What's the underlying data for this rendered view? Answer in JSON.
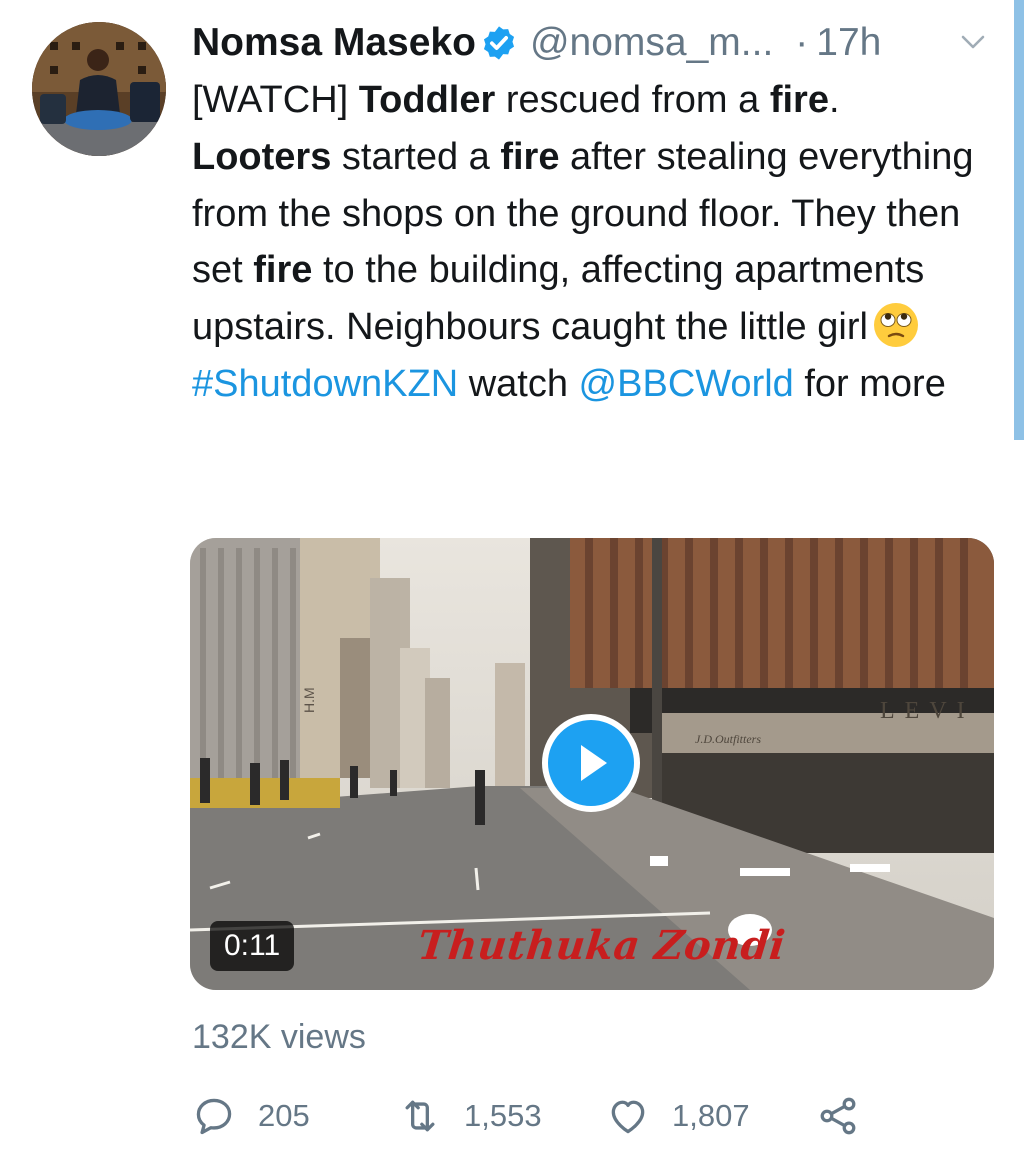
{
  "tweet": {
    "display_name": "Nomsa Maseko",
    "handle": "@nomsa_m...",
    "separator": "·",
    "time": "17h",
    "text": {
      "l1_a": "[WATCH] ",
      "l1_b": "Toddler",
      "l1_c": " rescued from a ",
      "l1_d": "fire",
      "l1_e": ".",
      "l2_a": "Looters",
      "l2_b": " started a ",
      "l2_c": "fire",
      "l2_d": " after stealing everything from the shops on the ground floor. They then set ",
      "l2_e": "fire",
      "l2_f": " to the building, affecting apartments upstairs. Neighbours caught the little girl",
      "hashtag": "#ShutdownKZN",
      "mid": " watch ",
      "mention": "@BBCWorld",
      "end": " for more"
    },
    "emoji": "face-with-rolling-eyes-emoji",
    "media": {
      "duration": "0:11",
      "watermark": "Thuthuka Zondi",
      "sign_levis": "LEVI",
      "sign_jd": "J.D.Outfitters",
      "sign_hm": "H.M",
      "play_icon": "play-icon"
    },
    "views": "132K views",
    "actions": {
      "reply_count": "205",
      "retweet_count": "1,553",
      "like_count": "1,807"
    }
  },
  "colors": {
    "link": "#1b95e0",
    "secondary_text": "#657786",
    "verified": "#1da1f2",
    "play_button": "#1da1f2",
    "watermark": "#c81e1e"
  }
}
